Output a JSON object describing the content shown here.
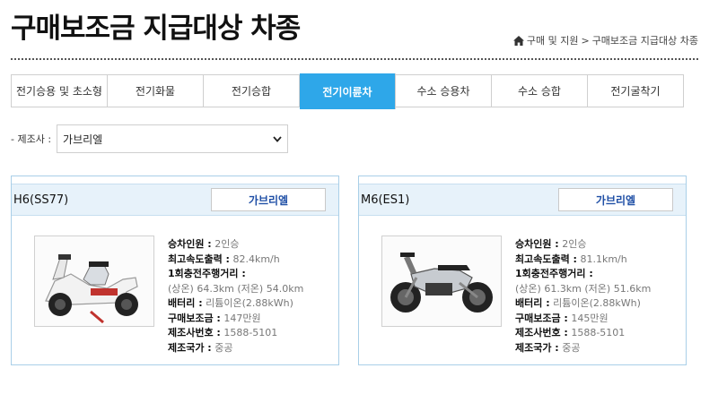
{
  "header": {
    "title": "구매보조금 지급대상 차종",
    "breadcrumb": [
      "구매 및 지원",
      ">",
      "구매보조금 지급대상 차종"
    ]
  },
  "tabs": [
    {
      "label": "전기승용 및 초소형",
      "active": false
    },
    {
      "label": "전기화물",
      "active": false
    },
    {
      "label": "전기승합",
      "active": false
    },
    {
      "label": "전기이륜차",
      "active": true
    },
    {
      "label": "수소 승용차",
      "active": false
    },
    {
      "label": "수소 승합",
      "active": false
    },
    {
      "label": "전기굴착기",
      "active": false
    }
  ],
  "filter": {
    "label": "- 제조사 :",
    "selected": "가브리엘"
  },
  "cards": [
    {
      "model": "H6(SS77)",
      "manufacturer_button": "가브리엘",
      "image_icon": "white-scooter-image",
      "seats_label": "승차인원 :",
      "seats_value": "2인승",
      "speed_label": "최고속도출력 :",
      "speed_value": "82.4km/h",
      "range_label": "1회충전주행거리 :",
      "range_value": "(상온) 64.3km (저온) 54.0km",
      "battery_label": "배터리 :",
      "battery_value": "리튬이온(2.88kWh)",
      "subsidy_label": "구매보조금 :",
      "subsidy_value": "147만원",
      "phone_label": "제조사번호 :",
      "phone_value": "1588-5101",
      "country_label": "제조국가 :",
      "country_value": "중공"
    },
    {
      "model": "M6(ES1)",
      "manufacturer_button": "가브리엘",
      "image_icon": "silver-motorcycle-image",
      "seats_label": "승차인원 :",
      "seats_value": "2인승",
      "speed_label": "최고속도출력 :",
      "speed_value": "81.1km/h",
      "range_label": "1회충전주행거리 :",
      "range_value": "(상온) 61.3km (저온) 51.6km",
      "battery_label": "배터리 :",
      "battery_value": "리튬이온(2.88kWh)",
      "subsidy_label": "구매보조금 :",
      "subsidy_value": "145만원",
      "phone_label": "제조사번호 :",
      "phone_value": "1588-5101",
      "country_label": "제조국가 :",
      "country_value": "중공"
    }
  ],
  "colors": {
    "active_tab": "#2ea7e9",
    "card_border": "#a9cfe8",
    "card_header": "#e7f2fa",
    "button_text": "#1f4fa6"
  }
}
